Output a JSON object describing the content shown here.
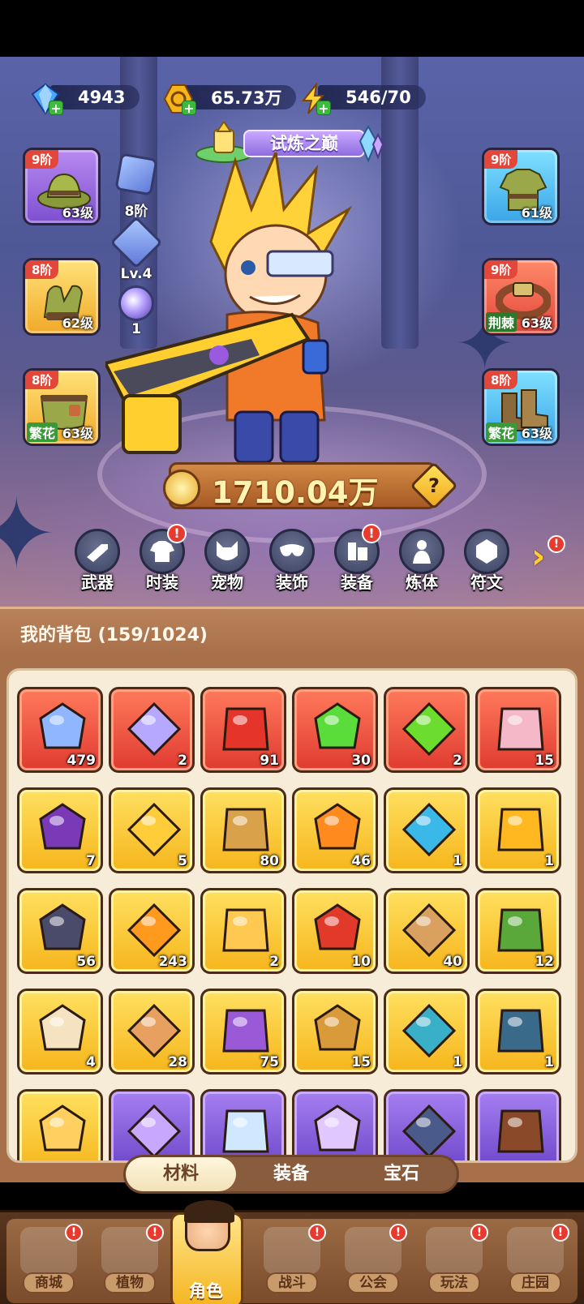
{
  "currencies": [
    {
      "name": "diamond-icon",
      "value": "4943",
      "color": "#4aa8ff"
    },
    {
      "name": "gold-coin-icon",
      "value": "65.73万",
      "color": "#f6b51c"
    },
    {
      "name": "energy-icon",
      "value": "546/70",
      "color": "#ffd23a"
    }
  ],
  "event_banner": {
    "label": "试炼之巅"
  },
  "equipment": {
    "left": [
      {
        "id": "hat",
        "tier": "9阶",
        "level": "63级",
        "prefix": "",
        "rarity": "purple",
        "icon": "hat-icon"
      },
      {
        "id": "gloves",
        "tier": "8阶",
        "level": "62级",
        "prefix": "",
        "rarity": "gold",
        "icon": "gloves-icon"
      },
      {
        "id": "pants",
        "tier": "8阶",
        "level": "63级",
        "prefix": "繁花",
        "rarity": "gold",
        "icon": "pants-icon"
      }
    ],
    "right": [
      {
        "id": "armor",
        "tier": "9阶",
        "level": "61级",
        "prefix": "",
        "rarity": "blue",
        "icon": "armor-icon"
      },
      {
        "id": "belt",
        "tier": "9阶",
        "level": "63级",
        "prefix": "荆棘",
        "rarity": "red",
        "icon": "belt-icon"
      },
      {
        "id": "boots",
        "tier": "8阶",
        "level": "63级",
        "prefix": "繁花",
        "rarity": "blue",
        "icon": "boots-icon"
      }
    ]
  },
  "mini_stats": {
    "wing_tier": "8阶",
    "crystal_level": "Lv.4",
    "orb_count": "1"
  },
  "combat_power": "1710.04万",
  "function_menu": [
    {
      "label": "武器",
      "icon": "weapon-icon",
      "badge": false
    },
    {
      "label": "时装",
      "icon": "outfit-icon",
      "badge": true
    },
    {
      "label": "宠物",
      "icon": "pet-icon",
      "badge": false
    },
    {
      "label": "装饰",
      "icon": "mask-icon",
      "badge": false
    },
    {
      "label": "装备",
      "icon": "equipment-icon",
      "badge": true
    },
    {
      "label": "炼体",
      "icon": "body-refine-icon",
      "badge": false
    },
    {
      "label": "符文",
      "icon": "rune-icon",
      "badge": false
    }
  ],
  "more_badge": "!",
  "badge_mark": "!",
  "backpack": {
    "title": "我的背包 (159/1024)",
    "items": [
      {
        "icon": "star-crystal-icon",
        "count": "479",
        "rarity": "red",
        "color": "#8fb6ff"
      },
      {
        "icon": "moon-crystal-icon",
        "count": "2",
        "rarity": "red",
        "color": "#b6a8ff"
      },
      {
        "icon": "red-potion-icon",
        "count": "91",
        "rarity": "red",
        "color": "#e5342a"
      },
      {
        "icon": "green-capsule-icon",
        "count": "30",
        "rarity": "red",
        "color": "#5adc3a"
      },
      {
        "icon": "green-pill-icon",
        "count": "2",
        "rarity": "red",
        "color": "#6cdc2e"
      },
      {
        "icon": "pink-knot-icon",
        "count": "15",
        "rarity": "red",
        "color": "#f5b8c8"
      },
      {
        "icon": "skull-scroll-icon",
        "count": "7",
        "rarity": "gold",
        "color": "#7a3ab8"
      },
      {
        "icon": "red-gem-key-icon",
        "count": "5",
        "rarity": "gold",
        "color": "#ffcc3a"
      },
      {
        "icon": "bronze-key-icon",
        "count": "80",
        "rarity": "gold",
        "color": "#d9a24a"
      },
      {
        "icon": "flame-pyramid-icon",
        "count": "46",
        "rarity": "gold",
        "color": "#ff8a1e"
      },
      {
        "icon": "blue-mushroom-icon",
        "count": "1",
        "rarity": "gold",
        "color": "#3ab8e8"
      },
      {
        "icon": "gold-orbit-icon",
        "count": "1",
        "rarity": "gold",
        "color": "#ffb820"
      },
      {
        "icon": "dark-rune-stone-icon",
        "count": "56",
        "rarity": "gold",
        "color": "#4a4a6a"
      },
      {
        "icon": "orange-potion-icon",
        "count": "243",
        "rarity": "gold",
        "color": "#ff9a1e"
      },
      {
        "icon": "golden-peaks-icon",
        "count": "2",
        "rarity": "gold",
        "color": "#ffc850"
      },
      {
        "icon": "red-flower-icon",
        "count": "10",
        "rarity": "gold",
        "color": "#e23a2a"
      },
      {
        "icon": "flower-pot-icon",
        "count": "40",
        "rarity": "gold",
        "color": "#d9a060"
      },
      {
        "icon": "spray-tank-icon",
        "count": "12",
        "rarity": "gold",
        "color": "#5aa83a"
      },
      {
        "icon": "bone-icon",
        "count": "4",
        "rarity": "gold",
        "color": "#f4e2c0"
      },
      {
        "icon": "cake-icon",
        "count": "28",
        "rarity": "gold",
        "color": "#e8a060"
      },
      {
        "icon": "spell-book-icon",
        "count": "75",
        "rarity": "gold",
        "color": "#9a5ad8"
      },
      {
        "icon": "puzzle-bird-icon",
        "count": "15",
        "rarity": "gold",
        "color": "#d99a3a"
      },
      {
        "icon": "spool-icon",
        "count": "1",
        "rarity": "gold",
        "color": "#3ab0c8"
      },
      {
        "icon": "map-chip-icon",
        "count": "1",
        "rarity": "gold",
        "color": "#3a6a8a"
      },
      {
        "icon": "gold-emblem-icon",
        "count": "",
        "rarity": "gold",
        "color": "#ffcf60"
      },
      {
        "icon": "purple-flask-icon",
        "count": "",
        "rarity": "purple",
        "color": "#c8a8ff"
      },
      {
        "icon": "ice-cube-icon",
        "count": "",
        "rarity": "purple",
        "color": "#d0e8ff"
      },
      {
        "icon": "crystal-box-icon",
        "count": "",
        "rarity": "purple",
        "color": "#e0c8ff"
      },
      {
        "icon": "rune-shield-icon",
        "count": "",
        "rarity": "purple",
        "color": "#4a5a8a"
      },
      {
        "icon": "brown-tome-icon",
        "count": "",
        "rarity": "purple",
        "color": "#8a4a2a"
      }
    ]
  },
  "bag_tabs": [
    {
      "label": "材料",
      "active": true
    },
    {
      "label": "装备",
      "active": false
    },
    {
      "label": "宝石",
      "active": false
    }
  ],
  "bottom_nav": [
    {
      "label": "商城",
      "icon": "shop-icon",
      "badge": true,
      "active": false
    },
    {
      "label": "植物",
      "icon": "plant-icon",
      "badge": true,
      "active": false
    },
    {
      "label": "角色",
      "icon": "character-avatar-icon",
      "badge": false,
      "active": true
    },
    {
      "label": "战斗",
      "icon": "battle-icon",
      "badge": true,
      "active": false
    },
    {
      "label": "公会",
      "icon": "guild-icon",
      "badge": true,
      "active": false
    },
    {
      "label": "玩法",
      "icon": "gameplay-icon",
      "badge": true,
      "active": false
    },
    {
      "label": "庄园",
      "icon": "manor-icon",
      "badge": true,
      "active": false
    }
  ]
}
